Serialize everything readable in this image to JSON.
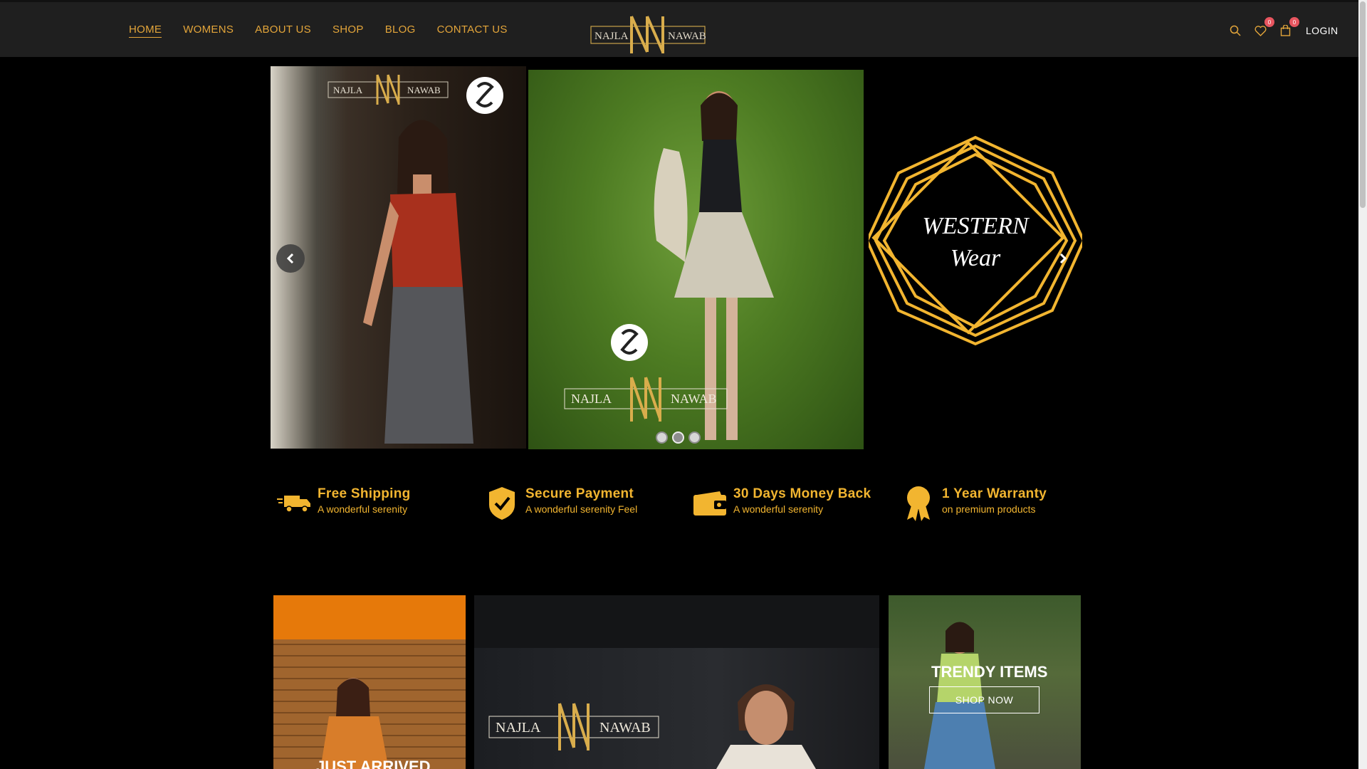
{
  "header": {
    "nav": [
      "HOME",
      "WOMENS",
      "ABOUT US",
      "SHOP",
      "BLOG",
      "CONTACT US"
    ],
    "active_nav": "HOME",
    "logo_left": "NAJLA",
    "logo_right": "NAWAB",
    "wishlist_count": "0",
    "cart_count": "0",
    "login_label": "LOGIN",
    "icons": [
      "search-icon",
      "heart-icon",
      "cart-icon"
    ]
  },
  "slider": {
    "slide3_title_line1": "WESTERN",
    "slide3_title_line2": "Wear",
    "watermark_left": "NAJLA",
    "watermark_right": "NAWAB",
    "dots": 3,
    "active_dot": 2
  },
  "features": [
    {
      "title": "Free Shipping",
      "subtitle": "A wonderful serenity",
      "icon": "truck-icon"
    },
    {
      "title": "Secure Payment",
      "subtitle": "A wonderful serenity Feel",
      "icon": "shield-check-icon"
    },
    {
      "title": "30 Days Money Back",
      "subtitle": "A wonderful serenity",
      "icon": "wallet-icon"
    },
    {
      "title": "1 Year Warranty",
      "subtitle": "on premium products",
      "icon": "award-icon"
    }
  ],
  "banners": {
    "left_title": "JUST ARRIVED",
    "middle_logo_left": "NAJLA",
    "middle_logo_right": "NAWAB",
    "right_title": "TRENDY ITEMS",
    "right_button": "SHOP NOW"
  },
  "colors": {
    "accent": "#e3a53a",
    "feature": "#f2b530",
    "header_bg": "#1f1f1f",
    "badge": "#e8555f"
  }
}
